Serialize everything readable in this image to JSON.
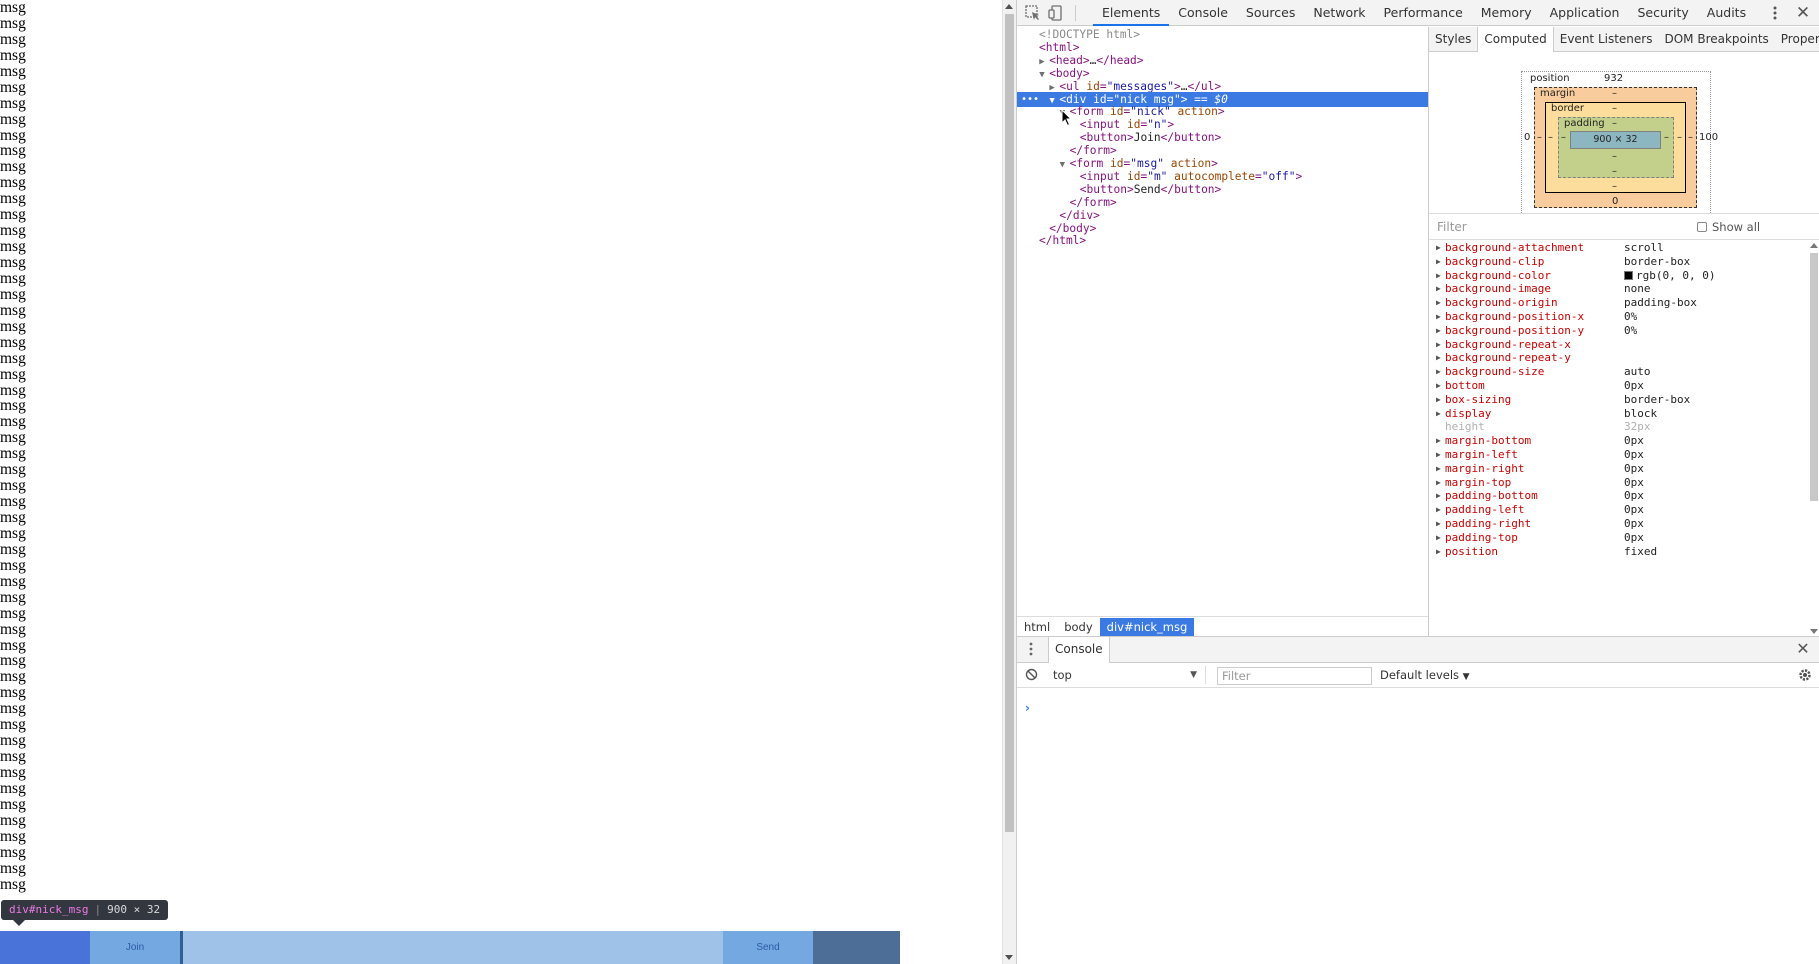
{
  "page": {
    "messages": [
      "msg",
      "msg",
      "msg",
      "msg",
      "msg",
      "msg",
      "msg",
      "msg",
      "msg",
      "msg",
      "msg",
      "msg",
      "msg",
      "msg",
      "msg",
      "msg",
      "msg",
      "msg",
      "msg",
      "msg",
      "msg",
      "msg",
      "msg",
      "msg",
      "msg",
      "msg",
      "msg",
      "msg",
      "msg",
      "msg",
      "msg",
      "msg",
      "msg",
      "msg",
      "msg",
      "msg",
      "msg",
      "msg",
      "msg",
      "msg",
      "msg",
      "msg",
      "msg",
      "msg",
      "msg",
      "msg",
      "msg",
      "msg",
      "msg",
      "msg",
      "msg",
      "msg",
      "msg",
      "msg",
      "msg",
      "msg"
    ],
    "nick_bar": {
      "join_label": "Join",
      "send_label": "Send"
    },
    "inspect_tooltip": {
      "selector": "div#nick_msg",
      "size": "900 × 32"
    }
  },
  "devtools": {
    "tabs": [
      "Elements",
      "Console",
      "Sources",
      "Network",
      "Performance",
      "Memory",
      "Application",
      "Security",
      "Audits"
    ],
    "active_tab": "Elements",
    "dom_tree": [
      {
        "indent": 0,
        "tri": "",
        "html": "doctype",
        "text": "<!DOCTYPE html>"
      },
      {
        "indent": 0,
        "tri": "",
        "open": "html"
      },
      {
        "indent": 1,
        "tri": "▶",
        "open": "head",
        "inner": "…",
        "close": "head"
      },
      {
        "indent": 1,
        "tri": "▼",
        "open": "body"
      },
      {
        "indent": 2,
        "tri": "▶",
        "open": "ul",
        "attrs": [
          [
            "id",
            "messages"
          ]
        ],
        "inner": "…",
        "close": "ul"
      },
      {
        "indent": 2,
        "tri": "▼",
        "open": "div",
        "attrs": [
          [
            "id",
            "nick msg"
          ]
        ],
        "selected": true,
        "suffix": " == $0"
      },
      {
        "indent": 3,
        "tri": "▼",
        "open": "form",
        "attrs": [
          [
            "id",
            "nick"
          ],
          [
            "action",
            ""
          ]
        ]
      },
      {
        "indent": 4,
        "tri": "",
        "open": "input",
        "attrs": [
          [
            "id",
            "n"
          ]
        ]
      },
      {
        "indent": 4,
        "tri": "",
        "open": "button",
        "inner": "Join",
        "close": "button"
      },
      {
        "indent": 3,
        "tri": "",
        "closeonly": "form"
      },
      {
        "indent": 3,
        "tri": "▼",
        "open": "form",
        "attrs": [
          [
            "id",
            "msg"
          ],
          [
            "action",
            ""
          ]
        ]
      },
      {
        "indent": 4,
        "tri": "",
        "open": "input",
        "attrs": [
          [
            "id",
            "m"
          ],
          [
            "autocomplete",
            "off"
          ]
        ]
      },
      {
        "indent": 4,
        "tri": "",
        "open": "button",
        "inner": "Send",
        "close": "button"
      },
      {
        "indent": 3,
        "tri": "",
        "closeonly": "form"
      },
      {
        "indent": 2,
        "tri": "",
        "closeonly": "div"
      },
      {
        "indent": 1,
        "tri": "",
        "closeonly": "body"
      },
      {
        "indent": 0,
        "tri": "",
        "closeonly": "html"
      }
    ],
    "breadcrumbs": [
      "html",
      "body",
      "div#nick_msg"
    ],
    "sidebar_tabs": [
      "Styles",
      "Computed",
      "Event Listeners",
      "DOM Breakpoints",
      "Properties"
    ],
    "active_sidebar_tab": "Computed",
    "box_model": {
      "position_label": "position",
      "position_value": "932",
      "margin_label": "margin",
      "border_label": "border",
      "padding_label": "padding",
      "dash": "–",
      "content": "900 × 32",
      "left_value": "0",
      "right_value": "100",
      "bottom_value": "0"
    },
    "filter_placeholder": "Filter",
    "show_all_label": "Show all",
    "computed": [
      {
        "name": "background-attachment",
        "value": "scroll"
      },
      {
        "name": "background-clip",
        "value": "border-box"
      },
      {
        "name": "background-color",
        "value": "rgb(0, 0, 0)",
        "swatch": "#000000"
      },
      {
        "name": "background-image",
        "value": "none"
      },
      {
        "name": "background-origin",
        "value": "padding-box"
      },
      {
        "name": "background-position-x",
        "value": "0%"
      },
      {
        "name": "background-position-y",
        "value": "0%"
      },
      {
        "name": "background-repeat-x",
        "value": ""
      },
      {
        "name": "background-repeat-y",
        "value": ""
      },
      {
        "name": "background-size",
        "value": "auto"
      },
      {
        "name": "bottom",
        "value": "0px"
      },
      {
        "name": "box-sizing",
        "value": "border-box"
      },
      {
        "name": "display",
        "value": "block"
      },
      {
        "name": "height",
        "value": "32px",
        "inherited": true
      },
      {
        "name": "margin-bottom",
        "value": "0px"
      },
      {
        "name": "margin-left",
        "value": "0px"
      },
      {
        "name": "margin-right",
        "value": "0px"
      },
      {
        "name": "margin-top",
        "value": "0px"
      },
      {
        "name": "padding-bottom",
        "value": "0px"
      },
      {
        "name": "padding-left",
        "value": "0px"
      },
      {
        "name": "padding-right",
        "value": "0px"
      },
      {
        "name": "padding-top",
        "value": "0px"
      },
      {
        "name": "position",
        "value": "fixed"
      }
    ],
    "drawer": {
      "tab": "Console",
      "context": "top",
      "filter_placeholder": "Filter",
      "levels": "Default levels",
      "prompt": "›"
    }
  },
  "colors": {
    "selection": "#3b7ae3",
    "accent": "#1a73e8"
  }
}
